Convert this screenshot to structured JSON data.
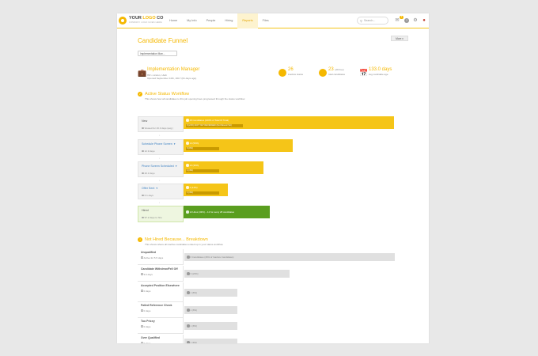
{
  "topbar": {
    "logo_main": "YOUR",
    "logo_accent": "LOGO",
    "logo_suffix": "CO",
    "logo_sub": "COMPANY LOGO GOES HERE",
    "nav": [
      "Home",
      "My Info",
      "People",
      "Hiring",
      "Reports",
      "Files"
    ],
    "active_nav": "Reports",
    "search_placeholder": "Search...",
    "notification_count": "2"
  },
  "page": {
    "title": "Candidate Funnel",
    "more_label": "More",
    "job_select": "Implementation Man..."
  },
  "summary": {
    "job_title": "Implementation Manager",
    "job_line1": "HR • Lindon, Utah",
    "job_line2": "Opened September 10th, 2017 (61 days ago)",
    "stat1_num": "26",
    "stat1_lbl": "inactive status",
    "stat2_num": "23",
    "stat2_num_suffix": "(29 free)",
    "stat2_lbl": "total candidates",
    "stat3_num": "133.0 days",
    "stat3_lbl": "avg candidate age"
  },
  "active_workflow": {
    "title": "Active Status Workflow",
    "subtitle": "This shows how all candidates to this job opening have progressed through the status workflow.",
    "stages": [
      {
        "name": "New",
        "meta": "Viewed for 16.3 days (avg.)",
        "bar_label": "28 Candidates (100% of Total Of Total)",
        "inner_label": "6 (21%) NOT YET REVIEWED (Not Moved Yet)",
        "fill": 1.0
      },
      {
        "name": "Schedule Phone Screen",
        "meta": "12.9 days",
        "bar_label": "14 (50%)",
        "inner_label": "6 (0%)",
        "fill": 0.52
      },
      {
        "name": "Phone Screen Scheduled",
        "meta": "20.3 days",
        "bar_label": "10 (36%)",
        "inner_label": "1 (4%)",
        "fill": 0.38
      },
      {
        "name": "Offer Sent",
        "meta": "0.1 days",
        "bar_label": "4 (14%)",
        "inner_label": "1 (4%)",
        "fill": 0.21
      },
      {
        "name": "Hired",
        "meta": "97.2 days to hire",
        "bar_label": "12 Hires (43%) – 12 for every 28 candidates",
        "fill": 0.41
      }
    ]
  },
  "not_hired": {
    "title": "Not Hired Because... Breakdown",
    "subtitle": "This shows where all inactive candidates ended up in your status workflow.",
    "rows": [
      {
        "name": "Unqualified",
        "meta": "Active for 5.5 days",
        "label": "6 Candidates (46% of Inactive Candidates)",
        "fill": 1.0
      },
      {
        "name": "Candidate Withdrew/Fell Off",
        "meta": "9.6 days",
        "label": "3 (23%)",
        "fill": 0.5
      },
      {
        "name": "Accepted Position Elsewhere",
        "meta": "0 days",
        "label": "1 (8%)",
        "fill": 0.25
      },
      {
        "name": "Failed Reference Check",
        "meta": "0 days",
        "label": "1 (8%)",
        "fill": 0.25
      },
      {
        "name": "Too Pricey",
        "meta": "0 days",
        "label": "1 (8%)",
        "fill": 0.25
      },
      {
        "name": "Over Qualified",
        "meta": "0 days",
        "label": "1 (8%)",
        "fill": 0.25
      }
    ]
  },
  "colors": {
    "accent": "#f5c518",
    "hired": "#5a9e1f",
    "link": "#3a7fc1"
  },
  "icons": [
    "logo-icon",
    "search-icon",
    "inbox-icon",
    "help-icon",
    "gear-icon",
    "user-icon",
    "briefcase-icon",
    "clock-icon",
    "person-icon",
    "calendar-icon"
  ]
}
